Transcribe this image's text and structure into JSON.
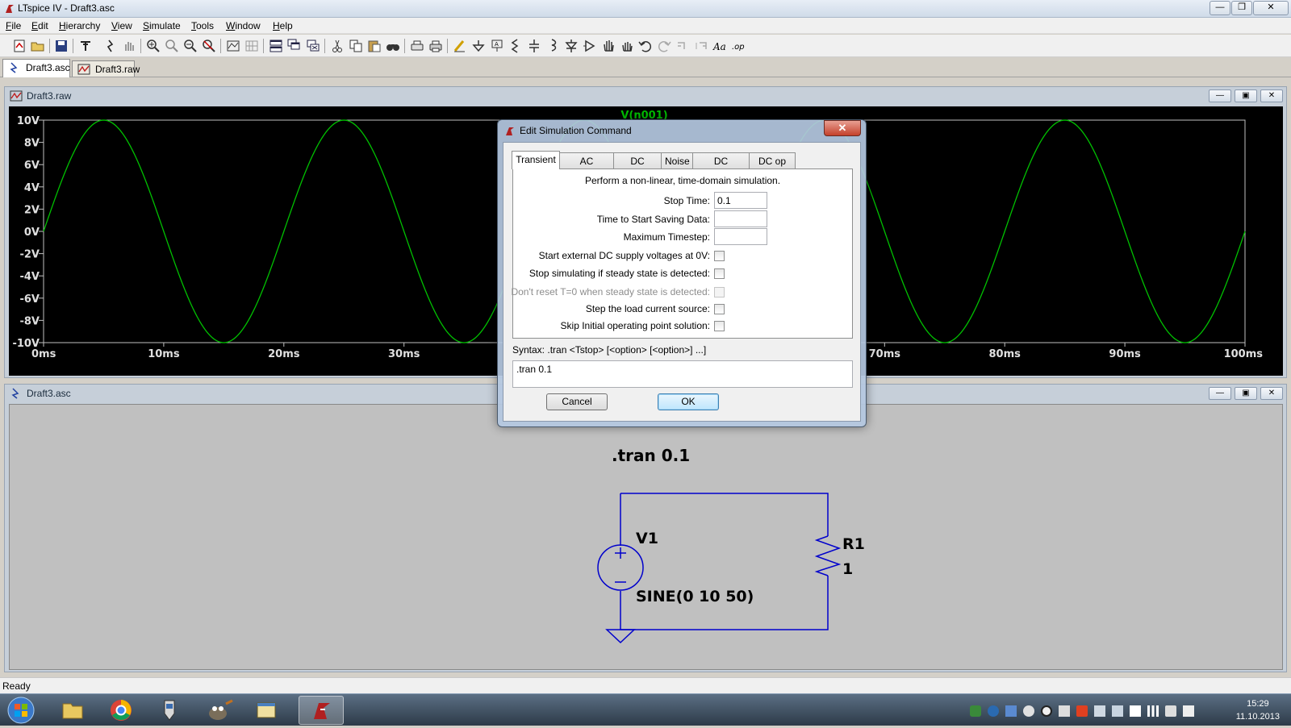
{
  "window": {
    "title": "LTspice IV - Draft3.asc",
    "minimize": "—",
    "maximize": "❐",
    "close": "✕"
  },
  "menu": [
    "File",
    "Edit",
    "Hierarchy",
    "View",
    "Simulate",
    "Tools",
    "Window",
    "Help"
  ],
  "doc_tabs": [
    {
      "label": "Draft3.asc",
      "icon": "schematic-icon"
    },
    {
      "label": "Draft3.raw",
      "icon": "waveform-icon"
    }
  ],
  "waveform_window": {
    "title": "Draft3.raw",
    "trace_label": "V(n001)",
    "trace_color": "#00c000"
  },
  "chart_data": {
    "type": "line",
    "title": "",
    "series": [
      {
        "name": "V(n001)",
        "function": "10*sin(2*pi*50*t)",
        "color": "#00c000"
      }
    ],
    "x_ticks": [
      "0ms",
      "10ms",
      "20ms",
      "30ms",
      "40ms",
      "50ms",
      "60ms",
      "70ms",
      "80ms",
      "90ms",
      "100ms"
    ],
    "y_ticks": [
      "10V",
      "8V",
      "6V",
      "4V",
      "2V",
      "0V",
      "-2V",
      "-4V",
      "-6V",
      "-8V",
      "-10V"
    ],
    "xlim": [
      0,
      0.1
    ],
    "ylim": [
      -10,
      10
    ]
  },
  "schematic_window": {
    "title": "Draft3.asc",
    "directive": ".tran 0.1",
    "source_name": "V1",
    "source_value": "SINE(0 10 50)",
    "resistor_name": "R1",
    "resistor_value": "1",
    "wire_color": "#0000cc"
  },
  "dialog": {
    "title": "Edit Simulation Command",
    "tabs": [
      "Transient",
      "AC Analysis",
      "DC sweep",
      "Noise",
      "DC Transfer",
      "DC op pnt"
    ],
    "active_tab": "Transient",
    "description": "Perform a non-linear, time-domain simulation.",
    "fields": [
      {
        "label": "Stop Time:",
        "value": "0.1"
      },
      {
        "label": "Time to Start Saving Data:",
        "value": ""
      },
      {
        "label": "Maximum Timestep:",
        "value": ""
      }
    ],
    "checkboxes": [
      {
        "label": "Start external DC supply voltages at 0V:",
        "checked": false,
        "disabled": false
      },
      {
        "label": "Stop simulating if steady state is detected:",
        "checked": false,
        "disabled": false
      },
      {
        "label": "Don't reset T=0 when steady state is detected:",
        "checked": false,
        "disabled": true
      },
      {
        "label": "Step the load current source:",
        "checked": false,
        "disabled": false
      },
      {
        "label": "Skip Initial operating point solution:",
        "checked": false,
        "disabled": false
      }
    ],
    "syntax": "Syntax:  .tran <Tstop> [<option> [<option>] ...]",
    "command": ".tran 0.1",
    "cancel_label": "Cancel",
    "ok_label": "OK"
  },
  "status": "Ready",
  "clock": {
    "time": "15:29",
    "date": "11.10.2013"
  }
}
